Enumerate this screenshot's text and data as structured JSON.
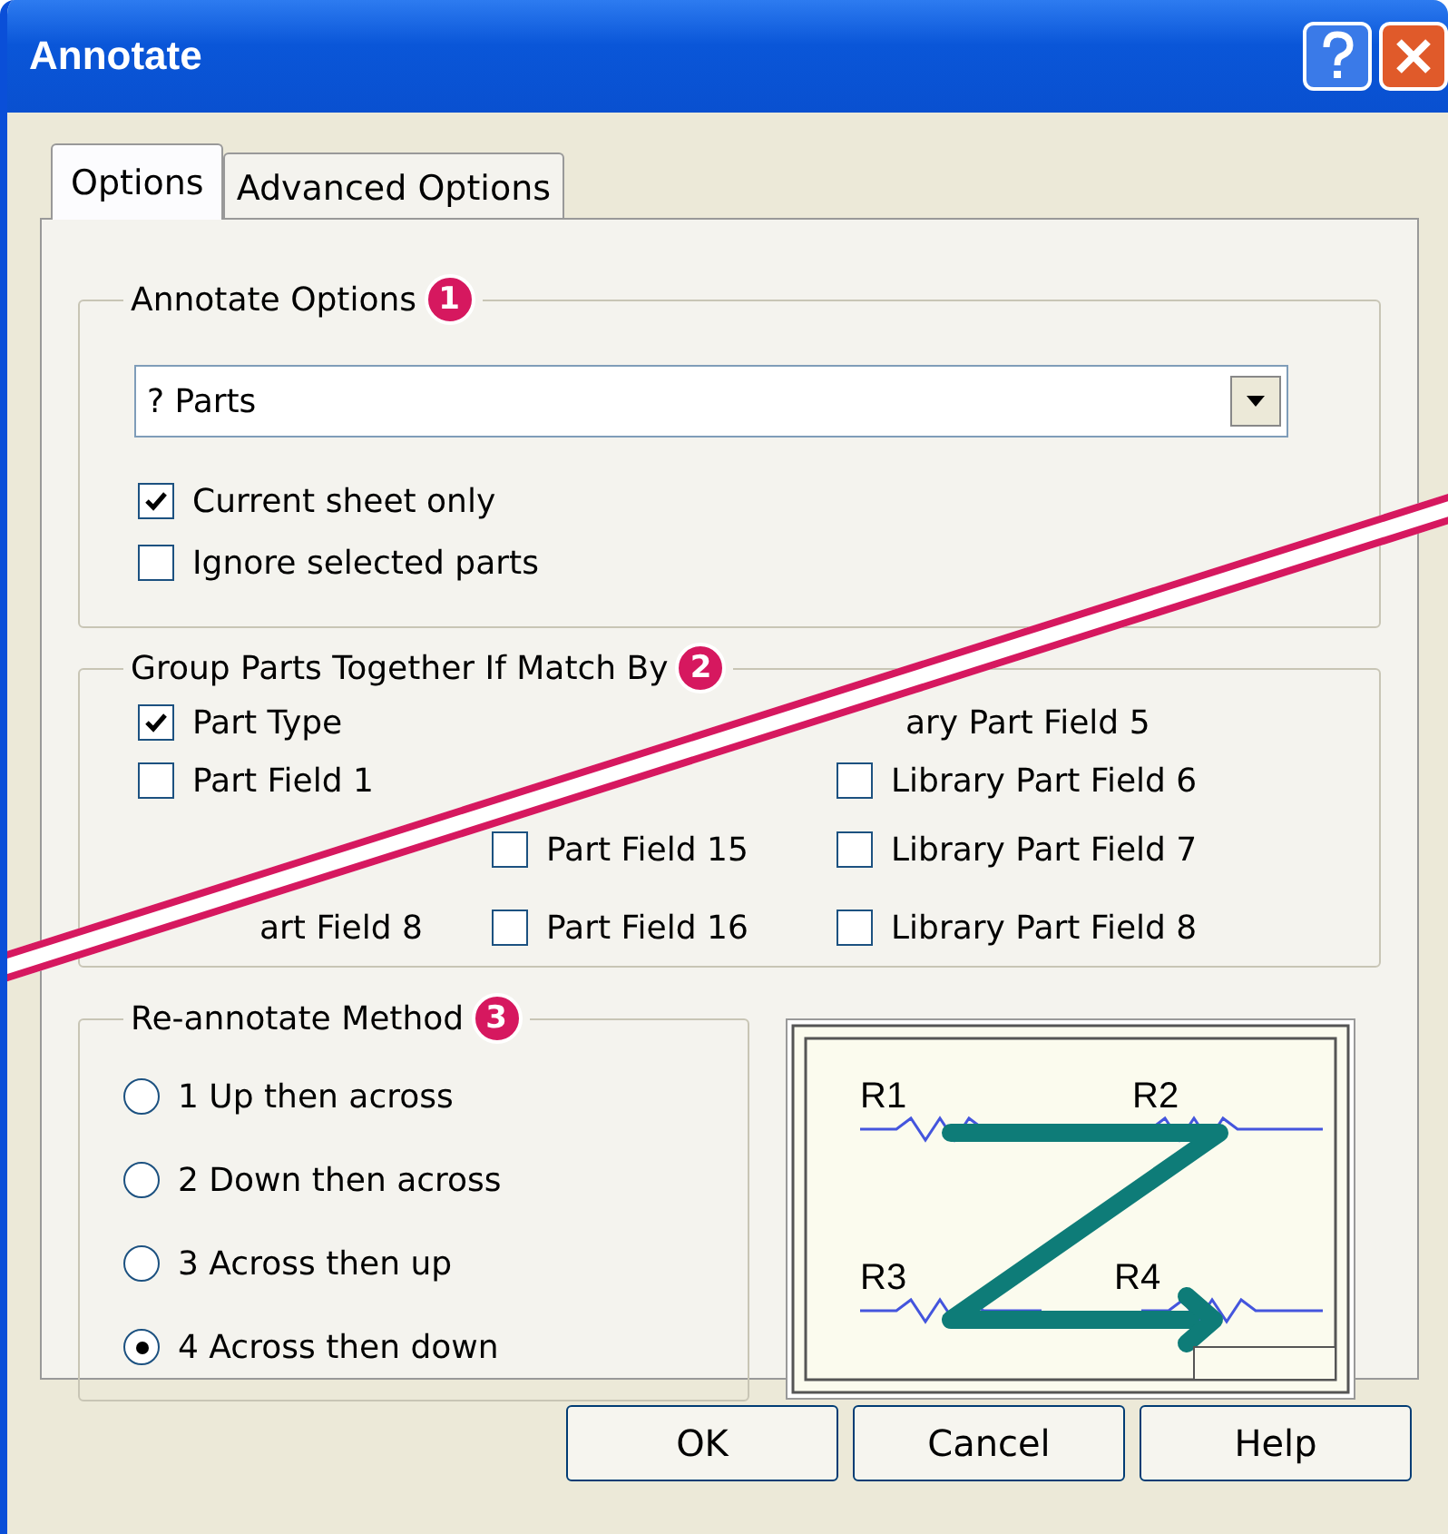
{
  "window": {
    "title": "Annotate"
  },
  "tabs": [
    {
      "label": "Options",
      "selected": true
    },
    {
      "label": "Advanced Options",
      "selected": false
    }
  ],
  "annotate_options": {
    "title": "Annotate Options",
    "badge": "1",
    "dropdown": {
      "value": "? Parts"
    },
    "checkboxes": [
      {
        "label": "Current sheet only",
        "checked": true
      },
      {
        "label": "Ignore selected parts",
        "checked": false
      }
    ]
  },
  "group_parts": {
    "title": "Group Parts Together If Match By",
    "badge": "2",
    "columns": [
      [
        {
          "kind": "checkbox",
          "label": "Part Type",
          "checked": true
        },
        {
          "kind": "checkbox",
          "label": "Part Field 1",
          "checked": false
        },
        {
          "kind": "cut_label",
          "label": "art Field 8"
        }
      ],
      [
        {
          "kind": "checkbox",
          "label": "Part Field 15",
          "checked": false
        },
        {
          "kind": "checkbox",
          "label": "Part Field 16",
          "checked": false
        }
      ],
      [
        {
          "kind": "cut_label",
          "label": "ary Part Field 5"
        },
        {
          "kind": "checkbox",
          "label": "Library Part Field 6",
          "checked": false
        },
        {
          "kind": "checkbox",
          "label": "Library Part Field 7",
          "checked": false
        },
        {
          "kind": "checkbox",
          "label": "Library Part Field 8",
          "checked": false
        }
      ]
    ]
  },
  "reannotate": {
    "title": "Re-annotate Method",
    "badge": "3",
    "options": [
      {
        "label": "1 Up then across",
        "selected": false
      },
      {
        "label": "2 Down then across",
        "selected": false
      },
      {
        "label": "3 Across then up",
        "selected": false
      },
      {
        "label": "4 Across then down",
        "selected": true
      }
    ],
    "diagram_labels": [
      "R1",
      "R2",
      "R3",
      "R4"
    ]
  },
  "buttons": [
    "OK",
    "Cancel",
    "Help"
  ]
}
